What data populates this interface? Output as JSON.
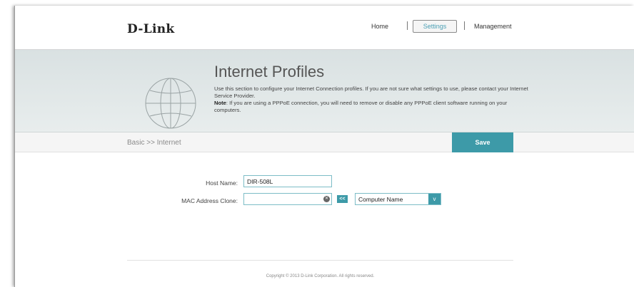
{
  "header": {
    "logo": "D-Link",
    "nav": {
      "home": "Home",
      "settings": "Settings",
      "management": "Management"
    }
  },
  "banner": {
    "title": "Internet Profiles",
    "desc_line1": "Use this section to configure your Internet Connection profiles. If you are not sure what settings to use, please contact your Internet Service Provider.",
    "note_label": "Note",
    "note_text": ": If you are using a PPPoE connection, you will need to remove or disable any PPPoE client software running on your computers."
  },
  "bar": {
    "breadcrumb": "Basic >> Internet",
    "save_label": "Save"
  },
  "form": {
    "host_label": "Host Name:",
    "host_value": "DIR-508L",
    "mac_label": "MAC Address Clone:",
    "mac_value": "",
    "copy_label": "<<",
    "select_value": "Computer Name",
    "select_arrow": "v"
  },
  "footer": {
    "copyright": "Copyright © 2013 D-Link Corporation. All rights reserved."
  },
  "colors": {
    "accent": "#3d9aa8",
    "banner": "#dde4e5"
  }
}
